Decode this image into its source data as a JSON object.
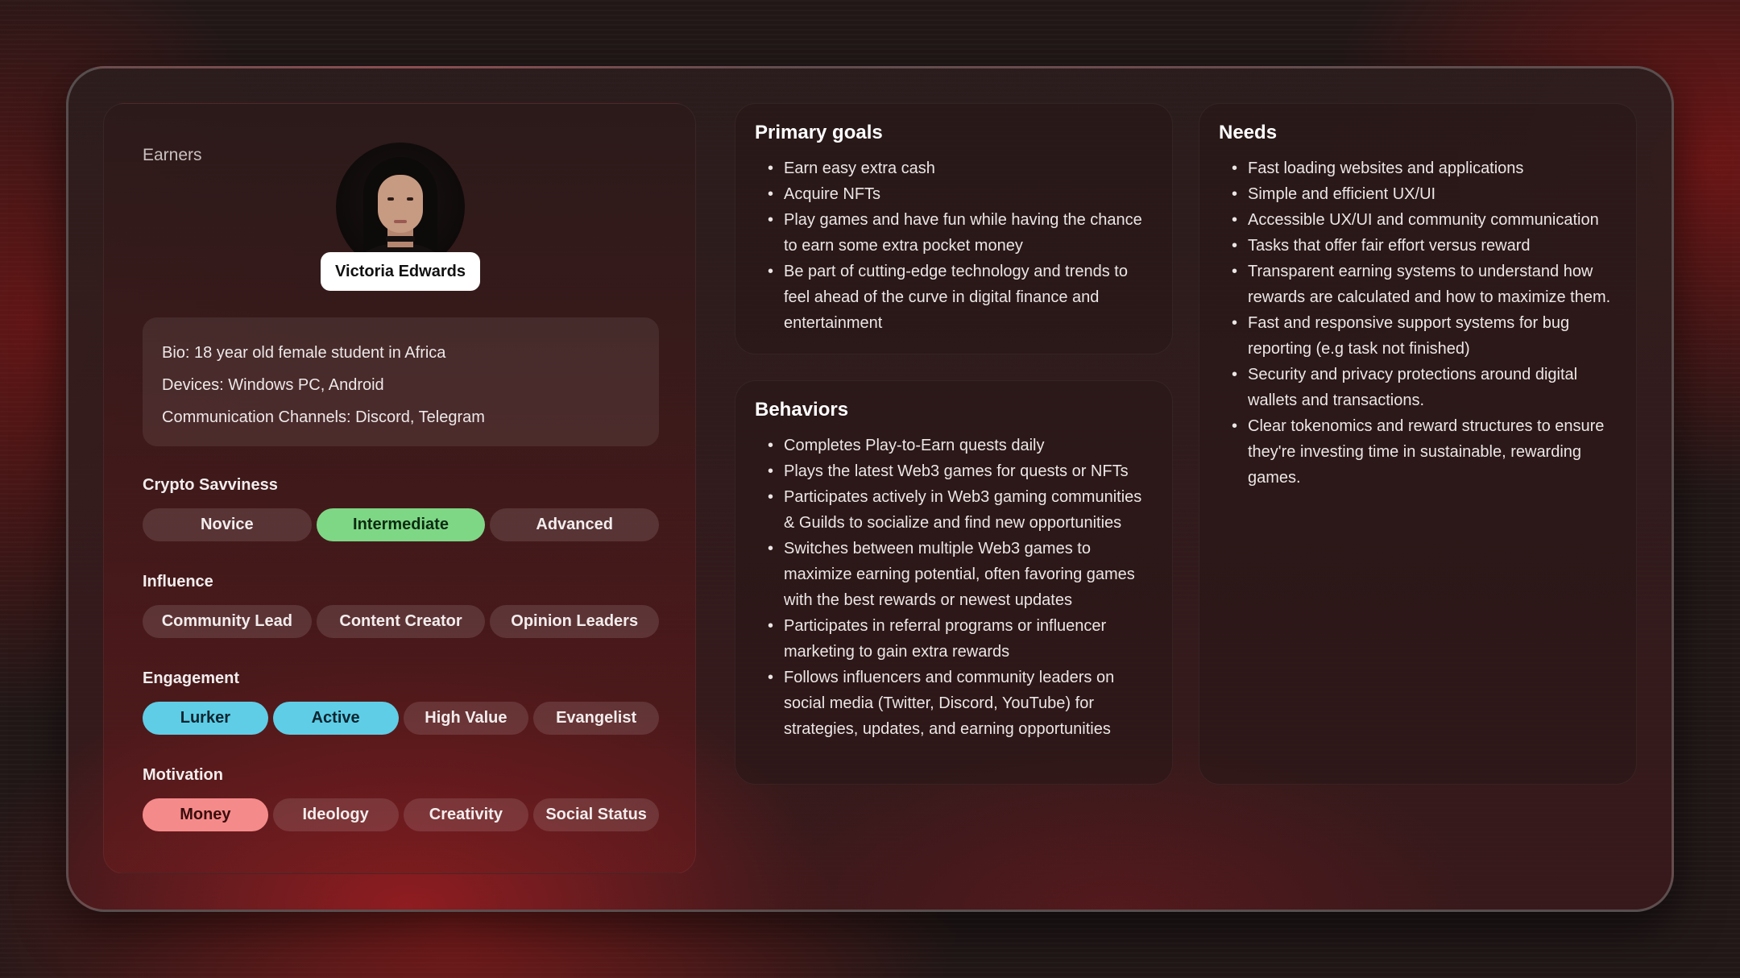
{
  "profile": {
    "category": "Earners",
    "name": "Victoria Edwards",
    "bio": [
      "Bio: 18 year old female student in Africa",
      "Devices: Windows PC, Android",
      "Communication Channels: Discord, Telegram"
    ]
  },
  "attributes": {
    "crypto": {
      "title": "Crypto Savviness",
      "options": [
        "Novice",
        "Intermediate",
        "Advanced"
      ],
      "selected": [
        "Intermediate"
      ],
      "accent": "#7ed785"
    },
    "influence": {
      "title": "Influence",
      "options": [
        "Community Lead",
        "Content Creator",
        "Opinion Leaders"
      ],
      "selected": []
    },
    "engagement": {
      "title": "Engagement",
      "options": [
        "Lurker",
        "Active",
        "High Value",
        "Evangelist"
      ],
      "selected": [
        "Lurker",
        "Active"
      ],
      "accent": "#5fcde6"
    },
    "motivation": {
      "title": "Motivation",
      "options": [
        "Money",
        "Ideology",
        "Creativity",
        "Social Status"
      ],
      "selected": [
        "Money"
      ],
      "accent": "#f58a8a"
    }
  },
  "goals": {
    "title": "Primary goals",
    "items": [
      "Earn easy extra cash",
      "Acquire NFTs",
      "Play games and have fun while having the chance to earn some extra pocket money",
      "Be part of cutting-edge technology and trends to feel ahead of the curve in digital finance and entertainment"
    ]
  },
  "behaviors": {
    "title": "Behaviors",
    "items": [
      "Completes Play-to-Earn quests daily",
      "Plays the latest Web3 games for quests or NFTs",
      "Participates actively in Web3 gaming communities & Guilds to socialize and find new opportunities",
      "Switches between multiple Web3 games to maximize earning potential, often favoring games with the best rewards or newest updates",
      "Participates in referral programs or influencer marketing to gain extra rewards",
      "Follows influencers and community leaders on social media (Twitter, Discord, YouTube) for strategies, updates, and earning opportunities"
    ]
  },
  "needs": {
    "title": "Needs",
    "items": [
      "Fast loading websites and applications",
      "Simple and efficient UX/UI",
      "Accessible UX/UI and community communication",
      "Tasks that offer fair effort versus reward",
      "Transparent earning systems to understand how rewards are calculated and how to maximize them.",
      "Fast and responsive support systems for bug reporting (e.g task not finished)",
      "Security and privacy protections around digital wallets and transactions.",
      "Clear tokenomics and reward structures to ensure they're investing time in sustainable, rewarding games."
    ]
  }
}
